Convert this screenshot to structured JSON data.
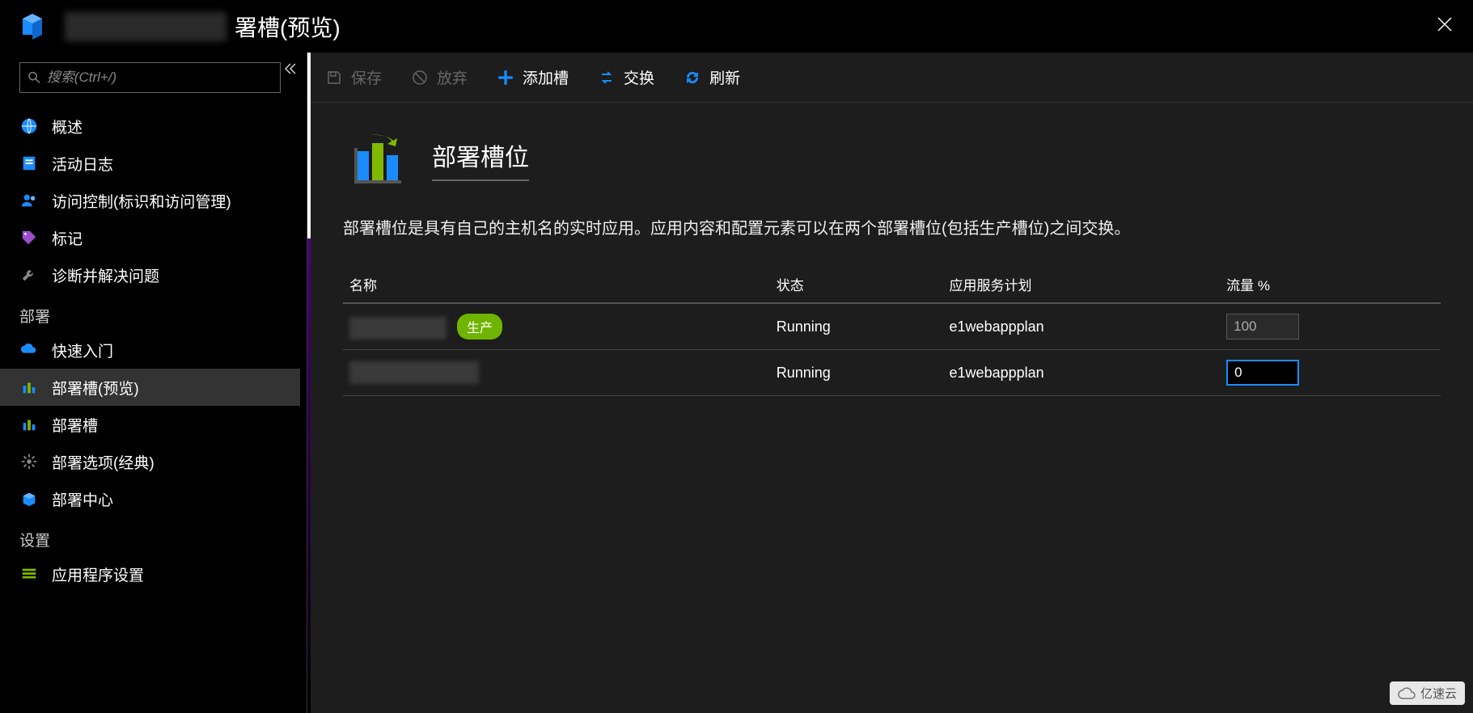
{
  "header": {
    "title_suffix": "署槽(预览)"
  },
  "sidebar": {
    "search_placeholder": "搜索(Ctrl+/)",
    "items_top": [
      {
        "id": "overview",
        "label": "概述"
      },
      {
        "id": "activity-log",
        "label": "活动日志"
      },
      {
        "id": "access-control",
        "label": "访问控制(标识和访问管理)"
      },
      {
        "id": "tags",
        "label": "标记"
      },
      {
        "id": "diagnose",
        "label": "诊断并解决问题"
      }
    ],
    "section_deploy": "部署",
    "items_deploy": [
      {
        "id": "quickstart",
        "label": "快速入门"
      },
      {
        "id": "deployment-slots-preview",
        "label": "部署槽(预览)",
        "active": true
      },
      {
        "id": "deployment-slots",
        "label": "部署槽"
      },
      {
        "id": "deployment-options",
        "label": "部署选项(经典)"
      },
      {
        "id": "deployment-center",
        "label": "部署中心"
      }
    ],
    "section_settings": "设置",
    "items_settings": [
      {
        "id": "app-settings",
        "label": "应用程序设置"
      }
    ]
  },
  "toolbar": {
    "save": "保存",
    "discard": "放弃",
    "add_slot": "添加槽",
    "swap": "交换",
    "refresh": "刷新"
  },
  "content": {
    "hero_title": "部署槽位",
    "description": "部署槽位是具有自己的主机名的实时应用。应用内容和配置元素可以在两个部署槽位(包括生产槽位)之间交换。",
    "columns": {
      "name": "名称",
      "status": "状态",
      "plan": "应用服务计划",
      "traffic": "流量 %"
    },
    "rows": [
      {
        "badge": "生产",
        "status": "Running",
        "plan": "e1webappplan",
        "traffic": "100",
        "readonly": true
      },
      {
        "badge": "",
        "status": "Running",
        "plan": "e1webappplan",
        "traffic": "0",
        "readonly": false
      }
    ]
  },
  "watermark": "亿速云"
}
